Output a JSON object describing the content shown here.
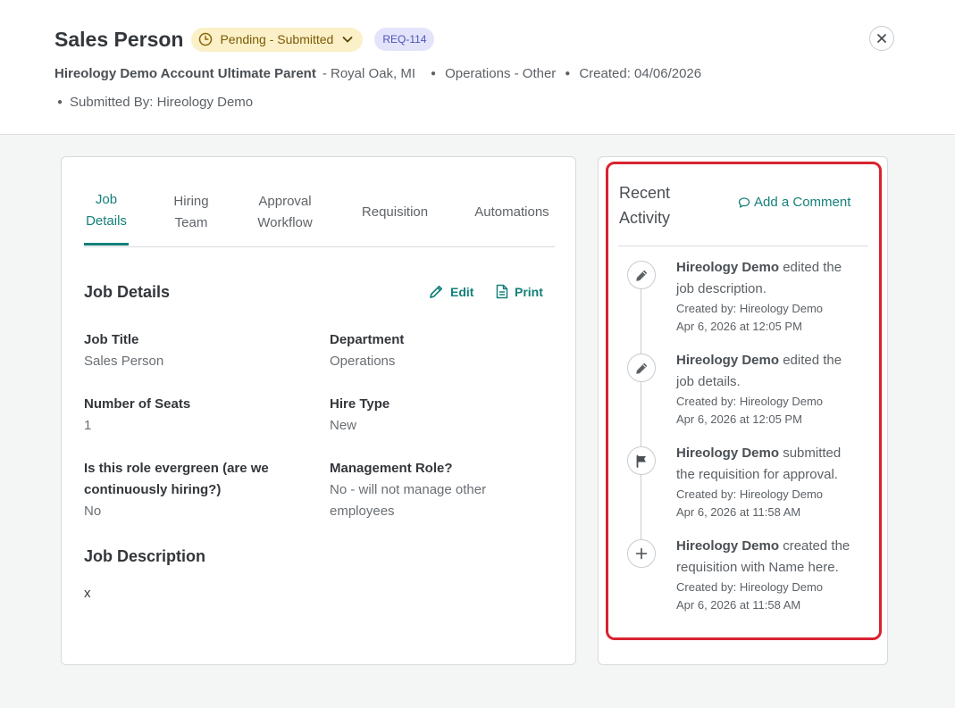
{
  "header": {
    "title": "Sales Person",
    "status": "Pending - Submitted",
    "req_id": "REQ-114",
    "company": "Hireology Demo Account Ultimate Parent",
    "location": "- Royal Oak, MI",
    "department": "Operations - Other",
    "created": "Created: 04/06/2026",
    "submitted_by": "Submitted By: Hireology Demo"
  },
  "tabs": [
    {
      "line1": "Job",
      "line2": "Details"
    },
    {
      "line1": "Hiring",
      "line2": "Team"
    },
    {
      "line1": "Approval",
      "line2": "Workflow"
    },
    {
      "label": "Requisition"
    },
    {
      "label": "Automations"
    }
  ],
  "job_details": {
    "title": "Job Details",
    "edit_label": "Edit",
    "print_label": "Print",
    "fields": {
      "job_title": {
        "label": "Job Title",
        "value": "Sales Person"
      },
      "department": {
        "label": "Department",
        "value": "Operations"
      },
      "seats": {
        "label": "Number of Seats",
        "value": "1"
      },
      "hire_type": {
        "label": "Hire Type",
        "value": "New"
      },
      "evergreen": {
        "label_line1": "Is this role evergreen (are we",
        "label_line2": "continuously hiring?)",
        "value": "No"
      },
      "management": {
        "label": "Management Role?",
        "value_line1": "No - will not manage other",
        "value_line2": "employees"
      }
    },
    "description_title": "Job Description",
    "description": "x"
  },
  "activity": {
    "title_line1": "Recent",
    "title_line2": "Activity",
    "add_comment": "Add a Comment",
    "items": [
      {
        "icon": "pencil-icon",
        "who": "Hireology Demo",
        "action_line1": " edited the",
        "action_line2": "job description.",
        "created_by": "Created by: Hireology Demo",
        "time": "Apr 6, 2026 at 12:05 PM"
      },
      {
        "icon": "pencil-icon",
        "who": "Hireology Demo",
        "action_line1": " edited the",
        "action_line2": "job details.",
        "created_by": "Created by: Hireology Demo",
        "time": "Apr 6, 2026 at 12:05 PM"
      },
      {
        "icon": "flag-icon",
        "who": "Hireology Demo",
        "action_line1": " submitted",
        "action_line2": "the requisition for approval.",
        "created_by": "Created by: Hireology Demo",
        "time": "Apr 6, 2026 at 11:58 AM"
      },
      {
        "icon": "plus-icon",
        "who": "Hireology Demo",
        "action_line1": " created the",
        "action_line2": "requisition with Name here.",
        "created_by": "Created by: Hireology Demo",
        "time": "Apr 6, 2026 at 11:58 AM"
      }
    ]
  },
  "colors": {
    "accent": "#14807a",
    "status_bg": "#fbf0c7",
    "badge_bg": "#e3e4fb",
    "highlight": "#d8232f"
  }
}
